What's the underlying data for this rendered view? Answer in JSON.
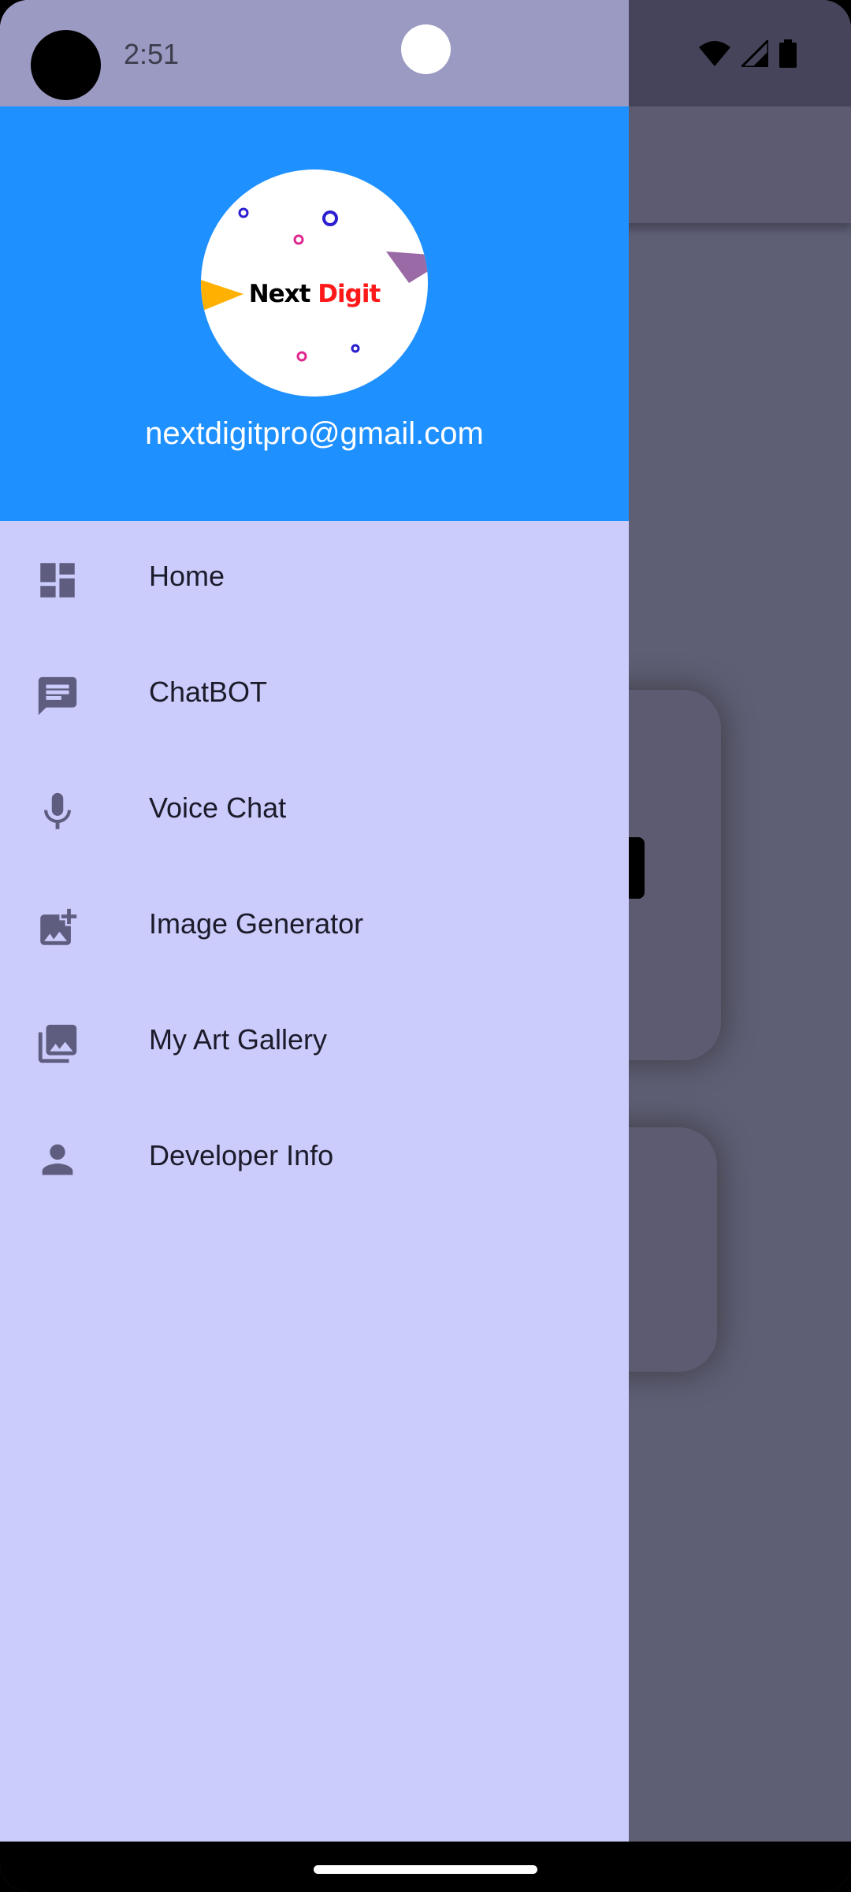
{
  "status_bar": {
    "time": "2:51",
    "icons": [
      "wifi-icon",
      "cell-signal-icon",
      "battery-icon"
    ]
  },
  "drawer": {
    "header": {
      "logo": {
        "word1": "Next",
        "word2": "Digit"
      },
      "email": "nextdigitpro@gmail.com",
      "background_color": "#1E90FF"
    },
    "items": [
      {
        "label": "Home",
        "icon": "dashboard-icon"
      },
      {
        "label": "ChatBOT",
        "icon": "chat-icon"
      },
      {
        "label": "Voice Chat",
        "icon": "mic-icon"
      },
      {
        "label": "Image Generator",
        "icon": "add-photo-icon"
      },
      {
        "label": "My Art Gallery",
        "icon": "photo-library-icon"
      },
      {
        "label": "Developer Info",
        "icon": "person-icon"
      }
    ],
    "background_color": "#CBCBFC"
  }
}
